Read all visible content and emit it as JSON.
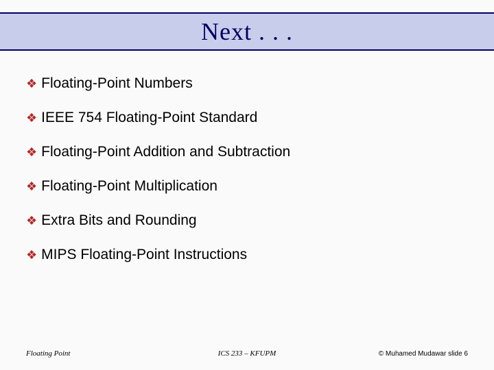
{
  "title": "Next . . .",
  "bullets": [
    "Floating-Point Numbers",
    "IEEE 754 Floating-Point Standard",
    "Floating-Point Addition and Subtraction",
    "Floating-Point Multiplication",
    "Extra Bits and Rounding",
    "MIPS Floating-Point Instructions"
  ],
  "footer": {
    "left": "Floating Point",
    "center": "ICS 233 – KFUPM",
    "right": "© Muhamed Mudawar slide 6"
  },
  "bullet_glyph": "❖"
}
